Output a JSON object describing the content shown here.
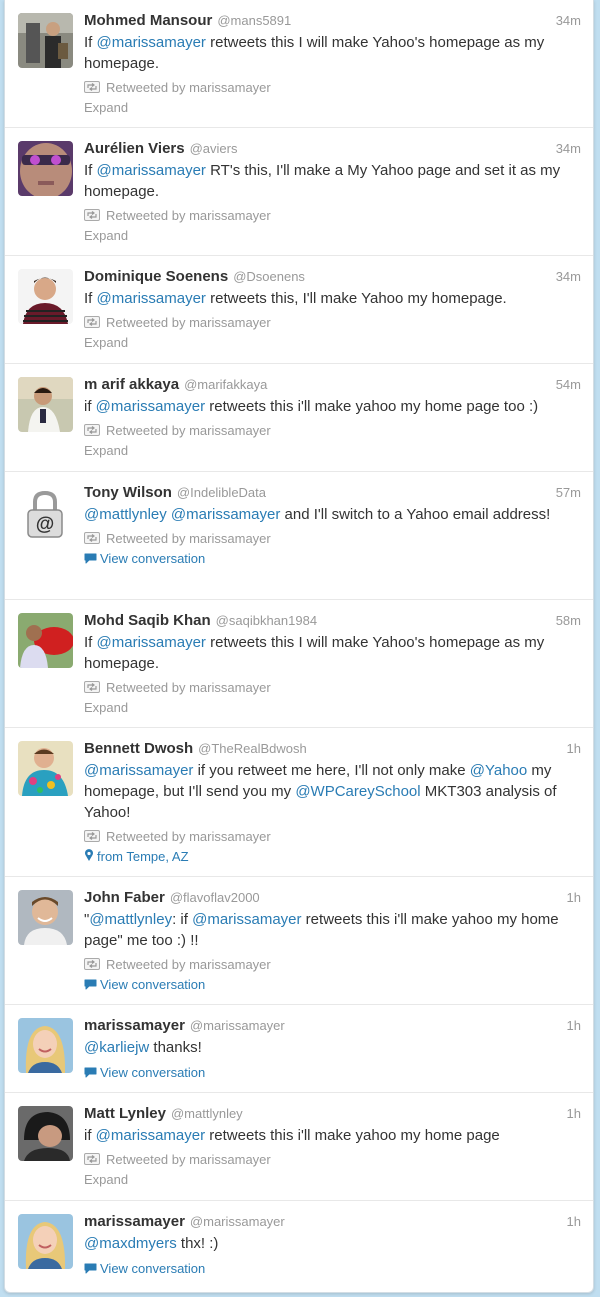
{
  "colors": {
    "link": "#2a7cb4",
    "meta": "#999999",
    "text": "#333333",
    "page_background": "#c0def0"
  },
  "tweets": [
    {
      "fullname": "Mohmed Mansour",
      "username": "@mans5891",
      "time": "34m",
      "text_parts": [
        [
          "If ",
          false
        ],
        [
          "@marissamayer",
          true
        ],
        [
          " retweets this I will make Yahoo's homepage as my homepage.",
          false
        ]
      ],
      "retweeted": "Retweeted by marissamayer",
      "action": "Expand",
      "action_type": "expand",
      "avatar": "man-with-bag"
    },
    {
      "fullname": "Aurélien Viers",
      "username": "@aviers",
      "time": "34m",
      "text_parts": [
        [
          "If ",
          false
        ],
        [
          "@marissamayer",
          true
        ],
        [
          " RT's this, I'll make a My Yahoo page and set it as my homepage.",
          false
        ]
      ],
      "retweeted": "Retweeted by marissamayer",
      "action": "Expand",
      "action_type": "expand",
      "avatar": "face-closeup"
    },
    {
      "fullname": "Dominique Soenens",
      "username": "@Dsoenens",
      "time": "34m",
      "text_parts": [
        [
          "If ",
          false
        ],
        [
          "@marissamayer",
          true
        ],
        [
          " retweets this, I'll make Yahoo my homepage.",
          false
        ]
      ],
      "retweeted": "Retweeted by marissamayer",
      "action": "Expand",
      "action_type": "expand",
      "avatar": "man-striped-shirt"
    },
    {
      "fullname": "m arif akkaya",
      "username": "@marifakkaya",
      "time": "54m",
      "text_parts": [
        [
          "if ",
          false
        ],
        [
          "@marissamayer",
          true
        ],
        [
          " retweets this i'll make yahoo my home page too  :)",
          false
        ]
      ],
      "retweeted": "Retweeted by marissamayer",
      "action": "Expand",
      "action_type": "expand",
      "avatar": "man-portrait"
    },
    {
      "fullname": "Tony Wilson",
      "username": "@IndelibleData",
      "time": "57m",
      "text_parts": [
        [
          "@mattlynley",
          true
        ],
        [
          " ",
          false
        ],
        [
          "@marissamayer",
          true
        ],
        [
          " and I'll switch to a Yahoo email address!",
          false
        ]
      ],
      "retweeted": "Retweeted by marissamayer",
      "action": "View conversation",
      "action_type": "conversation",
      "avatar": "padlock-at"
    },
    {
      "fullname": "Mohd Saqib Khan",
      "username": "@saqibkhan1984",
      "time": "58m",
      "text_parts": [
        [
          "If ",
          false
        ],
        [
          "@marissamayer",
          true
        ],
        [
          " retweets this I will make Yahoo's homepage as my homepage.",
          false
        ]
      ],
      "retweeted": "Retweeted by marissamayer",
      "action": "Expand",
      "action_type": "expand",
      "avatar": "man-red-car"
    },
    {
      "fullname": "Bennett Dwosh",
      "username": "@TheRealBdwosh",
      "time": "1h",
      "text_parts": [
        [
          "@marissamayer",
          true
        ],
        [
          " if you retweet me here, I'll not only make ",
          false
        ],
        [
          "@Yahoo",
          true
        ],
        [
          " my homepage, but I'll send you my ",
          false
        ],
        [
          "@WPCareySchool",
          true
        ],
        [
          " MKT303 analysis of Yahoo!",
          false
        ]
      ],
      "retweeted": "Retweeted by marissamayer",
      "action": "from Tempe, AZ",
      "action_type": "location",
      "avatar": "man-colorful-shirt"
    },
    {
      "fullname": "John Faber",
      "username": "@flavoflav2000",
      "time": "1h",
      "text_parts": [
        [
          "\"",
          false
        ],
        [
          "@mattlynley",
          true
        ],
        [
          ": if ",
          false
        ],
        [
          "@marissamayer",
          true
        ],
        [
          " retweets this i'll make yahoo my home page\" me too :) !!",
          false
        ]
      ],
      "retweeted": "Retweeted by marissamayer",
      "action": "View conversation",
      "action_type": "conversation",
      "avatar": "man-smiling"
    },
    {
      "fullname": "marissamayer",
      "username": "@marissamayer",
      "time": "1h",
      "text_parts": [
        [
          "@karliejw",
          true
        ],
        [
          " thanks!",
          false
        ]
      ],
      "retweeted": "",
      "action": "View conversation",
      "action_type": "conversation",
      "avatar": "blonde-woman"
    },
    {
      "fullname": "Matt Lynley",
      "username": "@mattlynley",
      "time": "1h",
      "text_parts": [
        [
          "if ",
          false
        ],
        [
          "@marissamayer",
          true
        ],
        [
          " retweets this i'll make yahoo my home page",
          false
        ]
      ],
      "retweeted": "Retweeted by marissamayer",
      "action": "Expand",
      "action_type": "expand",
      "avatar": "man-helmet"
    },
    {
      "fullname": "marissamayer",
      "username": "@marissamayer",
      "time": "1h",
      "text_parts": [
        [
          "@maxdmyers",
          true
        ],
        [
          " thx! :)",
          false
        ]
      ],
      "retweeted": "",
      "action": "View conversation",
      "action_type": "conversation",
      "avatar": "blonde-woman"
    }
  ]
}
